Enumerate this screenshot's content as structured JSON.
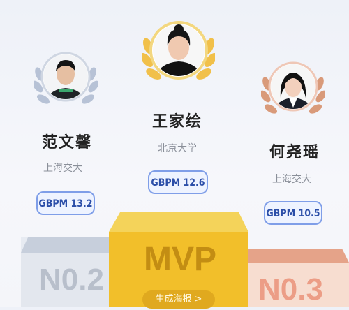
{
  "podium": {
    "first": {
      "name": "王家绘",
      "school": "北京大学",
      "score": "GBPM 12.6",
      "label": "MVP",
      "action": "生成海报 >"
    },
    "second": {
      "name": "范文馨",
      "school": "上海交大",
      "score": "GBPM 13.2",
      "label": "N0.2"
    },
    "third": {
      "name": "何尧瑶",
      "school": "上海交大",
      "score": "GBPM 10.5",
      "label": "N0.3"
    }
  },
  "colors": {
    "gold": "#f2bf2a",
    "silver": "#b9c3d3",
    "bronze": "#e49a7c",
    "badge_border": "#7f9ee8",
    "badge_text": "#2b4ea8"
  }
}
